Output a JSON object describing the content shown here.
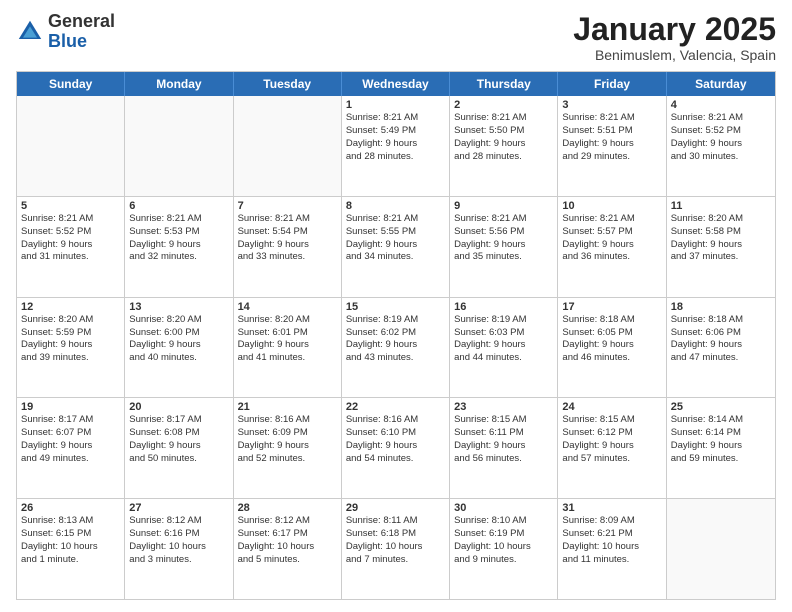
{
  "logo": {
    "general": "General",
    "blue": "Blue"
  },
  "header": {
    "title": "January 2025",
    "location": "Benimuslem, Valencia, Spain"
  },
  "weekdays": [
    "Sunday",
    "Monday",
    "Tuesday",
    "Wednesday",
    "Thursday",
    "Friday",
    "Saturday"
  ],
  "weeks": [
    [
      {
        "day": "",
        "lines": []
      },
      {
        "day": "",
        "lines": []
      },
      {
        "day": "",
        "lines": []
      },
      {
        "day": "1",
        "lines": [
          "Sunrise: 8:21 AM",
          "Sunset: 5:49 PM",
          "Daylight: 9 hours",
          "and 28 minutes."
        ]
      },
      {
        "day": "2",
        "lines": [
          "Sunrise: 8:21 AM",
          "Sunset: 5:50 PM",
          "Daylight: 9 hours",
          "and 28 minutes."
        ]
      },
      {
        "day": "3",
        "lines": [
          "Sunrise: 8:21 AM",
          "Sunset: 5:51 PM",
          "Daylight: 9 hours",
          "and 29 minutes."
        ]
      },
      {
        "day": "4",
        "lines": [
          "Sunrise: 8:21 AM",
          "Sunset: 5:52 PM",
          "Daylight: 9 hours",
          "and 30 minutes."
        ]
      }
    ],
    [
      {
        "day": "5",
        "lines": [
          "Sunrise: 8:21 AM",
          "Sunset: 5:52 PM",
          "Daylight: 9 hours",
          "and 31 minutes."
        ]
      },
      {
        "day": "6",
        "lines": [
          "Sunrise: 8:21 AM",
          "Sunset: 5:53 PM",
          "Daylight: 9 hours",
          "and 32 minutes."
        ]
      },
      {
        "day": "7",
        "lines": [
          "Sunrise: 8:21 AM",
          "Sunset: 5:54 PM",
          "Daylight: 9 hours",
          "and 33 minutes."
        ]
      },
      {
        "day": "8",
        "lines": [
          "Sunrise: 8:21 AM",
          "Sunset: 5:55 PM",
          "Daylight: 9 hours",
          "and 34 minutes."
        ]
      },
      {
        "day": "9",
        "lines": [
          "Sunrise: 8:21 AM",
          "Sunset: 5:56 PM",
          "Daylight: 9 hours",
          "and 35 minutes."
        ]
      },
      {
        "day": "10",
        "lines": [
          "Sunrise: 8:21 AM",
          "Sunset: 5:57 PM",
          "Daylight: 9 hours",
          "and 36 minutes."
        ]
      },
      {
        "day": "11",
        "lines": [
          "Sunrise: 8:20 AM",
          "Sunset: 5:58 PM",
          "Daylight: 9 hours",
          "and 37 minutes."
        ]
      }
    ],
    [
      {
        "day": "12",
        "lines": [
          "Sunrise: 8:20 AM",
          "Sunset: 5:59 PM",
          "Daylight: 9 hours",
          "and 39 minutes."
        ]
      },
      {
        "day": "13",
        "lines": [
          "Sunrise: 8:20 AM",
          "Sunset: 6:00 PM",
          "Daylight: 9 hours",
          "and 40 minutes."
        ]
      },
      {
        "day": "14",
        "lines": [
          "Sunrise: 8:20 AM",
          "Sunset: 6:01 PM",
          "Daylight: 9 hours",
          "and 41 minutes."
        ]
      },
      {
        "day": "15",
        "lines": [
          "Sunrise: 8:19 AM",
          "Sunset: 6:02 PM",
          "Daylight: 9 hours",
          "and 43 minutes."
        ]
      },
      {
        "day": "16",
        "lines": [
          "Sunrise: 8:19 AM",
          "Sunset: 6:03 PM",
          "Daylight: 9 hours",
          "and 44 minutes."
        ]
      },
      {
        "day": "17",
        "lines": [
          "Sunrise: 8:18 AM",
          "Sunset: 6:05 PM",
          "Daylight: 9 hours",
          "and 46 minutes."
        ]
      },
      {
        "day": "18",
        "lines": [
          "Sunrise: 8:18 AM",
          "Sunset: 6:06 PM",
          "Daylight: 9 hours",
          "and 47 minutes."
        ]
      }
    ],
    [
      {
        "day": "19",
        "lines": [
          "Sunrise: 8:17 AM",
          "Sunset: 6:07 PM",
          "Daylight: 9 hours",
          "and 49 minutes."
        ]
      },
      {
        "day": "20",
        "lines": [
          "Sunrise: 8:17 AM",
          "Sunset: 6:08 PM",
          "Daylight: 9 hours",
          "and 50 minutes."
        ]
      },
      {
        "day": "21",
        "lines": [
          "Sunrise: 8:16 AM",
          "Sunset: 6:09 PM",
          "Daylight: 9 hours",
          "and 52 minutes."
        ]
      },
      {
        "day": "22",
        "lines": [
          "Sunrise: 8:16 AM",
          "Sunset: 6:10 PM",
          "Daylight: 9 hours",
          "and 54 minutes."
        ]
      },
      {
        "day": "23",
        "lines": [
          "Sunrise: 8:15 AM",
          "Sunset: 6:11 PM",
          "Daylight: 9 hours",
          "and 56 minutes."
        ]
      },
      {
        "day": "24",
        "lines": [
          "Sunrise: 8:15 AM",
          "Sunset: 6:12 PM",
          "Daylight: 9 hours",
          "and 57 minutes."
        ]
      },
      {
        "day": "25",
        "lines": [
          "Sunrise: 8:14 AM",
          "Sunset: 6:14 PM",
          "Daylight: 9 hours",
          "and 59 minutes."
        ]
      }
    ],
    [
      {
        "day": "26",
        "lines": [
          "Sunrise: 8:13 AM",
          "Sunset: 6:15 PM",
          "Daylight: 10 hours",
          "and 1 minute."
        ]
      },
      {
        "day": "27",
        "lines": [
          "Sunrise: 8:12 AM",
          "Sunset: 6:16 PM",
          "Daylight: 10 hours",
          "and 3 minutes."
        ]
      },
      {
        "day": "28",
        "lines": [
          "Sunrise: 8:12 AM",
          "Sunset: 6:17 PM",
          "Daylight: 10 hours",
          "and 5 minutes."
        ]
      },
      {
        "day": "29",
        "lines": [
          "Sunrise: 8:11 AM",
          "Sunset: 6:18 PM",
          "Daylight: 10 hours",
          "and 7 minutes."
        ]
      },
      {
        "day": "30",
        "lines": [
          "Sunrise: 8:10 AM",
          "Sunset: 6:19 PM",
          "Daylight: 10 hours",
          "and 9 minutes."
        ]
      },
      {
        "day": "31",
        "lines": [
          "Sunrise: 8:09 AM",
          "Sunset: 6:21 PM",
          "Daylight: 10 hours",
          "and 11 minutes."
        ]
      },
      {
        "day": "",
        "lines": []
      }
    ]
  ]
}
